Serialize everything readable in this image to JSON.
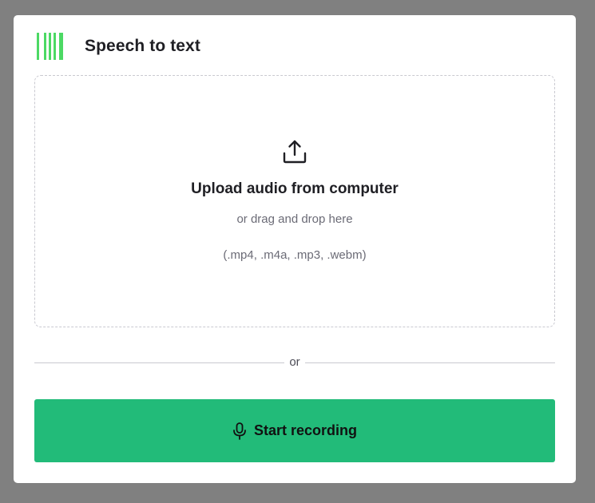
{
  "header": {
    "logo_icon": "waveform-bars-logo",
    "title": "Speech to text",
    "logo_color": "#4cd964"
  },
  "dropzone": {
    "icon": "upload-icon",
    "title": "Upload audio from computer",
    "subtitle": "or drag and drop here",
    "formats": "(.mp4, .m4a, .mp3, .webm)"
  },
  "divider": {
    "label": "or"
  },
  "record_button": {
    "icon": "microphone-icon",
    "label": "Start recording",
    "color": "#22bb79"
  }
}
